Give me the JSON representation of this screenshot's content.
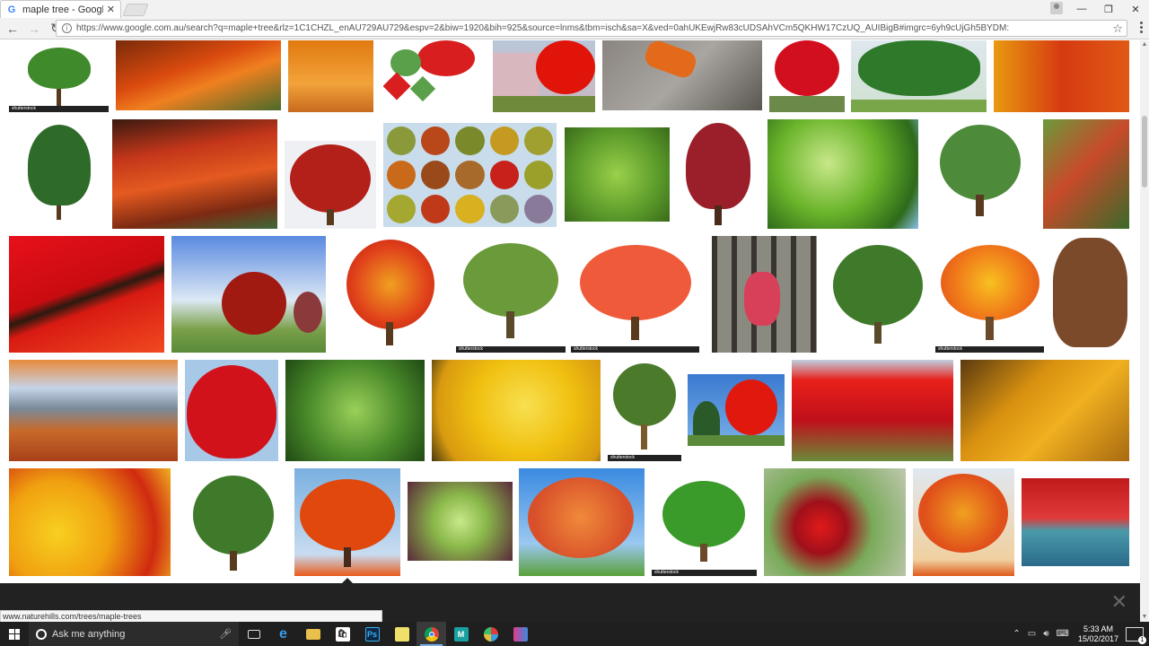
{
  "browser": {
    "tab_title": "maple tree - Google Sea",
    "tab_favicon": "G",
    "url": "https://www.google.com.au/search?q=maple+tree&rlz=1C1CHZL_enAU729AU729&espv=2&biw=1920&bih=925&source=lnms&tbm=isch&sa=X&ved=0ahUKEwjRw83cUDSAhVCm5QKHW17CzUQ_AUIBigB#imgrc=6yh9cUjGh5BYDM:"
  },
  "status_link": "www.naturehills.com/trees/maple-trees",
  "stock_label": "shutterstock",
  "taskbar": {
    "search_placeholder": "Ask me anything",
    "time": "5:33 AM",
    "date": "15/02/2017",
    "notification_count": "1",
    "app_labels": {
      "ps": "Ps",
      "maps": "M"
    }
  },
  "colors": {
    "red": "#c8140f",
    "orange": "#e0641a",
    "green": "#3f8a2a",
    "yellow": "#e9b300",
    "sky": "#6aa5e6",
    "chrome_bg": "#f2f2f2",
    "taskbar_bg": "#1f1f1f"
  }
}
